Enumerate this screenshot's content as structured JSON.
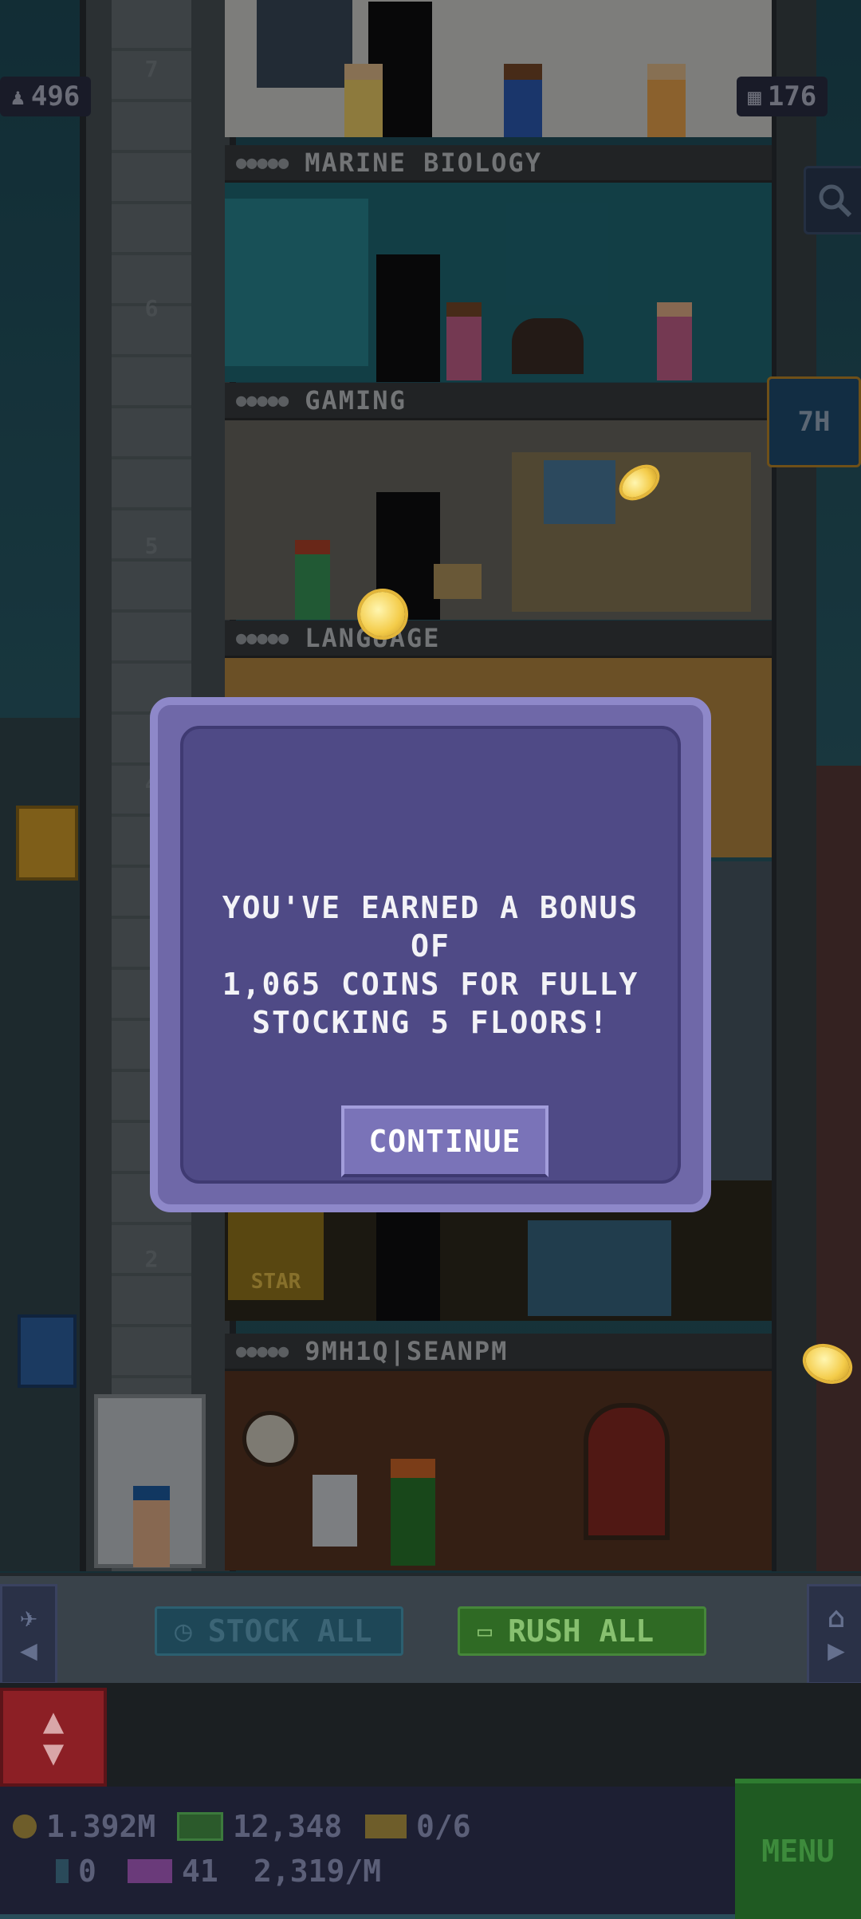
{
  "top_stats": {
    "population": "496",
    "floor_count": "176"
  },
  "side_buttons": {
    "timer": "7H"
  },
  "floors": [
    {
      "number": "7",
      "label": ""
    },
    {
      "number": "6",
      "label": "MARINE BIOLOGY"
    },
    {
      "number": "5",
      "label": "GAMING"
    },
    {
      "number": "4",
      "label": "LANGUAGE"
    },
    {
      "number": "2",
      "label": ""
    },
    {
      "number": "",
      "label": "9MH1Q|SEANPM"
    }
  ],
  "room_signs": {
    "star_sign": "STAR"
  },
  "modal": {
    "message": "YOU'VE EARNED A BONUS OF\n1,065 COINS FOR FULLY\nSTOCKING 5 FLOORS!",
    "button_label": "CONTINUE"
  },
  "actions": {
    "stock_all": "STOCK ALL",
    "rush_all": "RUSH ALL"
  },
  "status": {
    "coins": "1.392M",
    "bux": "12,348",
    "tickets": "0/6",
    "items": "0",
    "vip": "41",
    "income": "2,319/M",
    "menu_label": "MENU"
  },
  "colors": {
    "modal_outer": "#6f68a8",
    "modal_inner": "#4f4a86",
    "rush_green": "#2f6a24",
    "stock_teal": "#1e4757",
    "elevator_red": "#8c1f25"
  }
}
